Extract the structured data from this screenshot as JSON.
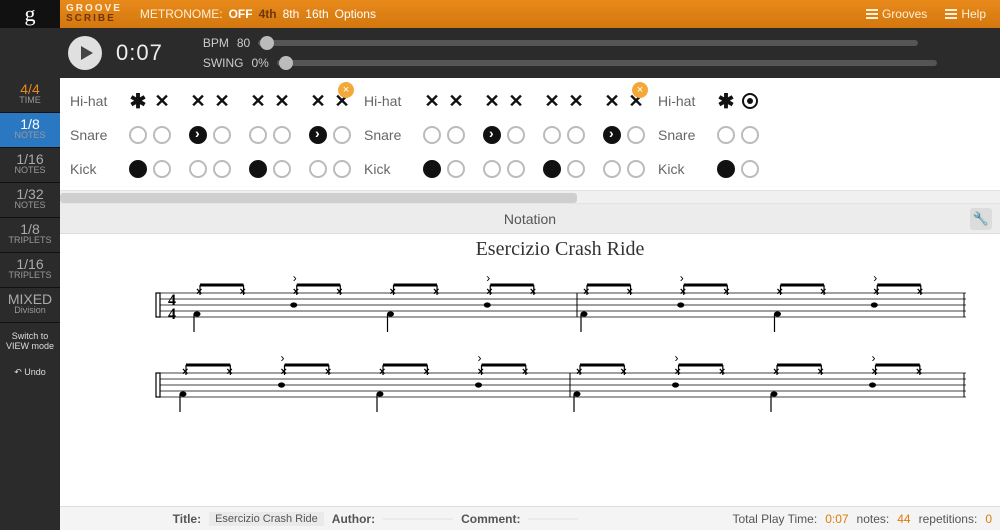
{
  "brand": {
    "line1": "GROOVE",
    "line2": "SCRIBE",
    "logo_g": "g"
  },
  "metronome": {
    "label": "METRONOME:",
    "off": "OFF",
    "options": [
      "4th",
      "8th",
      "16th",
      "Options"
    ],
    "selected": "4th"
  },
  "topnav": {
    "grooves": "Grooves",
    "help": "Help"
  },
  "transport": {
    "time": "0:07",
    "bpm_label": "BPM",
    "bpm_value": "80",
    "swing_label": "SWING",
    "swing_value": "0%"
  },
  "sidebar": [
    {
      "big": "4/4",
      "small": "TIME",
      "style": "gold"
    },
    {
      "big": "1/8",
      "small": "NOTES",
      "style": "blue"
    },
    {
      "big": "1/16",
      "small": "NOTES",
      "style": ""
    },
    {
      "big": "1/32",
      "small": "NOTES",
      "style": ""
    },
    {
      "big": "1/8",
      "small": "TRIPLETS",
      "style": ""
    },
    {
      "big": "1/16",
      "small": "TRIPLETS",
      "style": ""
    },
    {
      "big": "MIXED",
      "small": "Division",
      "style": ""
    }
  ],
  "sidebar_actions": {
    "switch": "Switch to VIEW mode",
    "undo": "Undo"
  },
  "instruments": {
    "hihat": "Hi-hat",
    "snare": "Snare",
    "kick": "Kick"
  },
  "measures": [
    {
      "hihat": [
        "star",
        "x",
        "x",
        "x",
        "x",
        "x",
        "x",
        "x"
      ],
      "snare": [
        "",
        "",
        "accent",
        "",
        "",
        "",
        "accent",
        ""
      ],
      "kick": [
        "fill",
        "",
        "",
        "",
        "fill",
        "",
        "",
        ""
      ]
    },
    {
      "hihat": [
        "x",
        "x",
        "x",
        "x",
        "x",
        "x",
        "x",
        "x"
      ],
      "snare": [
        "",
        "",
        "accent",
        "",
        "",
        "",
        "accent",
        ""
      ],
      "kick": [
        "fill",
        "",
        "",
        "",
        "fill",
        "",
        "",
        ""
      ]
    },
    {
      "partial": true,
      "hihat": [
        "star",
        "o"
      ],
      "snare": [
        "",
        ""
      ],
      "kick": [
        "fill",
        ""
      ]
    }
  ],
  "notation": {
    "header": "Notation",
    "title": "Esercizio Crash Ride",
    "timesig": "4/4"
  },
  "footer": {
    "title_label": "Title:",
    "title_value": "Esercizio Crash Ride",
    "author_label": "Author:",
    "author_value": "",
    "comment_label": "Comment:",
    "comment_value": "",
    "total_label": "Total Play Time:",
    "total_value": "0:07",
    "notes_label": "notes:",
    "notes_value": "44",
    "reps_label": "repetitions:",
    "reps_value": "0"
  },
  "colors": {
    "accent": "#e8891a",
    "blue": "#2a78c2"
  }
}
